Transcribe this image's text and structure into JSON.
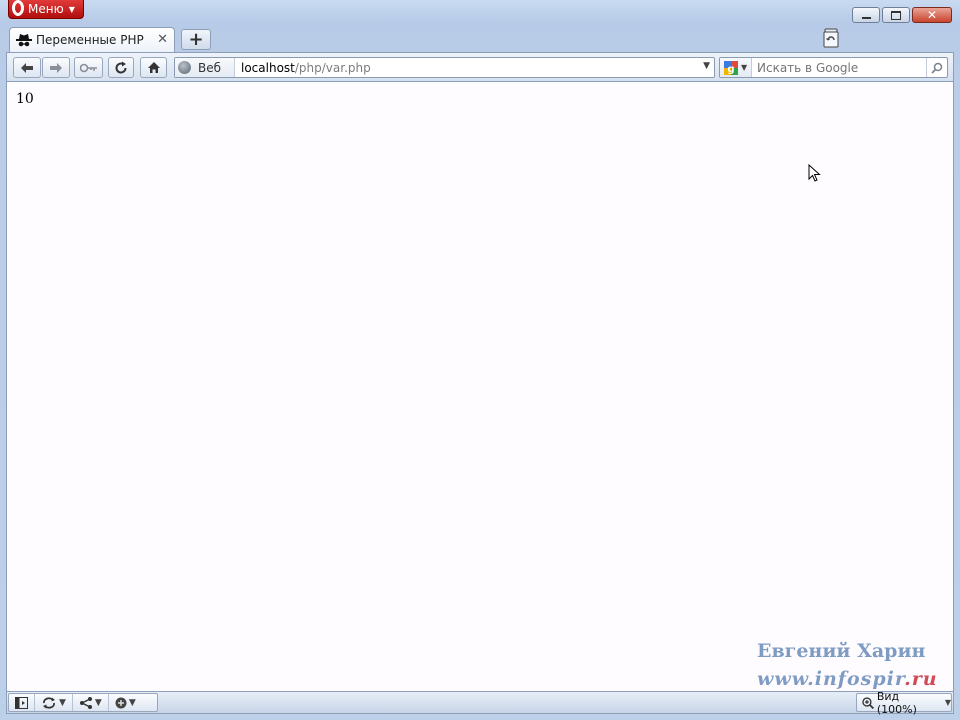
{
  "browser": {
    "menu_label": "Меню",
    "tab": {
      "title": "Переменные PHP"
    },
    "address": {
      "badge": "Веб",
      "host": "localhost",
      "path": "/php/var.php"
    },
    "search": {
      "placeholder": "Искать в Google"
    },
    "status": {
      "zoom_label": "Вид (100%)"
    }
  },
  "page": {
    "output_text": "10"
  },
  "watermark": {
    "line1": "Евгений Харин",
    "line2_main": "www.infospir",
    "line2_tld": ".ru"
  },
  "colors": {
    "menu_red": "#c41818",
    "frame_blue": "#b9cde9",
    "watermark_blue": "#7e9cc3",
    "watermark_red": "#d04a58"
  }
}
